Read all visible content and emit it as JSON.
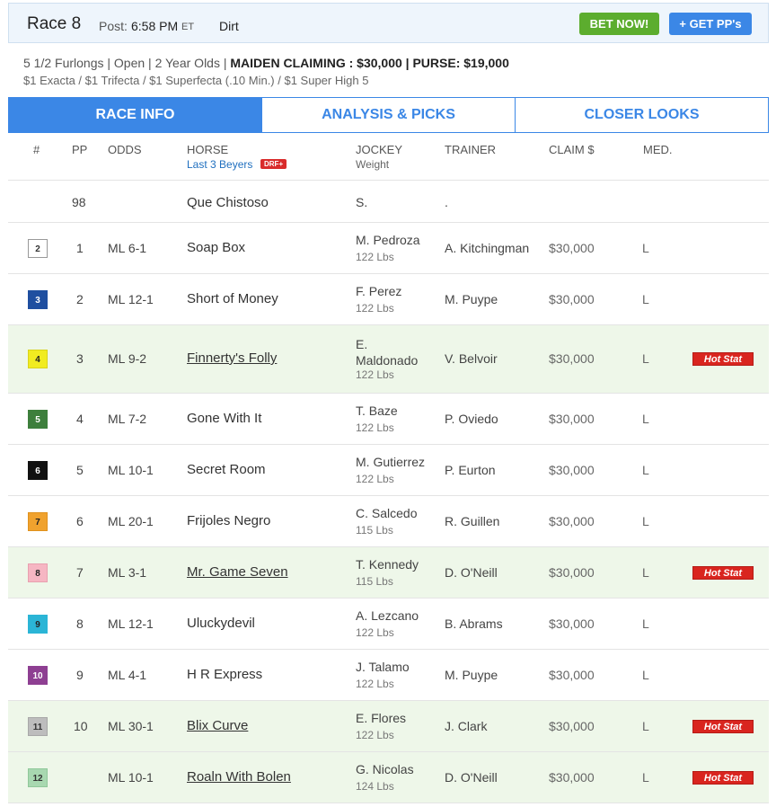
{
  "header": {
    "race": "Race 8",
    "post_label": "Post:",
    "post_time": "6:58 PM",
    "post_tz": "ET",
    "surface": "Dirt",
    "bet_button": "BET NOW!",
    "pp_button": "+ GET PP's"
  },
  "race_info": {
    "line1_prefix": "5 1/2 Furlongs | Open | 2 Year Olds | ",
    "line1_type": "MAIDEN CLAIMING : $30,000 | PURSE: $19,000",
    "line2": "$1 Exacta / $1 Trifecta / $1 Superfecta (.10 Min.) / $1 Super High 5"
  },
  "tabs": [
    {
      "label": "RACE INFO",
      "active": true
    },
    {
      "label": "ANALYSIS & PICKS",
      "active": false
    },
    {
      "label": "CLOSER LOOKS",
      "active": false
    }
  ],
  "columns": {
    "num": "#",
    "pp": "PP",
    "odds": "ODDS",
    "horse": "HORSE",
    "horse_sub": "Last 3 Beyers",
    "drf_badge": "DRF+",
    "jockey": "JOCKEY",
    "jockey_sub": "Weight",
    "trainer": "TRAINER",
    "claim": "CLAIM $",
    "med": "MED."
  },
  "hot_stat_label": "Hot Stat",
  "top_row": {
    "pp": "98",
    "horse": "Que Chistoso",
    "jockey": "S.",
    "trainer": "."
  },
  "entries": [
    {
      "num": "2",
      "pp": "1",
      "odds": "ML 6-1",
      "horse": "Soap Box",
      "jockey": "M. Pedroza",
      "weight": "122 Lbs",
      "trainer": "A. Kitchingman",
      "claim": "$30,000",
      "med": "L",
      "hot": false,
      "color": "#ffffff",
      "text_color": "#333333",
      "border": "#999999"
    },
    {
      "num": "3",
      "pp": "2",
      "odds": "ML 12-1",
      "horse": "Short of Money",
      "jockey": "F. Perez",
      "weight": "122 Lbs",
      "trainer": "M. Puype",
      "claim": "$30,000",
      "med": "L",
      "hot": false,
      "color": "#1f4fa0",
      "text_color": "#ffffff",
      "border": "#1f4fa0"
    },
    {
      "num": "4",
      "pp": "3",
      "odds": "ML 9-2",
      "horse": "Finnerty's Folly",
      "jockey": "E. Maldonado",
      "weight": "122 Lbs",
      "trainer": "V. Belvoir",
      "claim": "$30,000",
      "med": "L",
      "hot": true,
      "color": "#f1ec21",
      "text_color": "#222222",
      "border": "#d9d31a"
    },
    {
      "num": "5",
      "pp": "4",
      "odds": "ML 7-2",
      "horse": "Gone With It",
      "jockey": "T. Baze",
      "weight": "122 Lbs",
      "trainer": "P. Oviedo",
      "claim": "$30,000",
      "med": "L",
      "hot": false,
      "color": "#3d7f3c",
      "text_color": "#ffffff",
      "border": "#3d7f3c"
    },
    {
      "num": "6",
      "pp": "5",
      "odds": "ML 10-1",
      "horse": "Secret Room",
      "jockey": "M. Gutierrez",
      "weight": "122 Lbs",
      "trainer": "P. Eurton",
      "claim": "$30,000",
      "med": "L",
      "hot": false,
      "color": "#111111",
      "text_color": "#ffffff",
      "border": "#111111"
    },
    {
      "num": "7",
      "pp": "6",
      "odds": "ML 20-1",
      "horse": "Frijoles Negro",
      "jockey": "C. Salcedo",
      "weight": "115 Lbs",
      "trainer": "R. Guillen",
      "claim": "$30,000",
      "med": "L",
      "hot": false,
      "color": "#f0a22e",
      "text_color": "#222222",
      "border": "#e0921e"
    },
    {
      "num": "8",
      "pp": "7",
      "odds": "ML 3-1",
      "horse": "Mr. Game Seven",
      "jockey": "T. Kennedy",
      "weight": "115 Lbs",
      "trainer": "D. O'Neill",
      "claim": "$30,000",
      "med": "L",
      "hot": true,
      "color": "#f6b6c3",
      "text_color": "#222222",
      "border": "#e8a0b0"
    },
    {
      "num": "9",
      "pp": "8",
      "odds": "ML 12-1",
      "horse": "Uluckydevil",
      "jockey": "A. Lezcano",
      "weight": "122 Lbs",
      "trainer": "B. Abrams",
      "claim": "$30,000",
      "med": "L",
      "hot": false,
      "color": "#2bb5d6",
      "text_color": "#222222",
      "border": "#2bb5d6"
    },
    {
      "num": "10",
      "pp": "9",
      "odds": "ML 4-1",
      "horse": "H R Express",
      "jockey": "J. Talamo",
      "weight": "122 Lbs",
      "trainer": "M. Puype",
      "claim": "$30,000",
      "med": "L",
      "hot": false,
      "color": "#8e3f92",
      "text_color": "#ffffff",
      "border": "#8e3f92"
    },
    {
      "num": "11",
      "pp": "10",
      "odds": "ML 30-1",
      "horse": "Blix Curve",
      "jockey": "E. Flores",
      "weight": "122 Lbs",
      "trainer": "J. Clark",
      "claim": "$30,000",
      "med": "L",
      "hot": true,
      "color": "#bdbdbd",
      "text_color": "#333333",
      "border": "#a8a8a8"
    },
    {
      "num": "12",
      "pp": "",
      "odds": "ML 10-1",
      "horse": "Roaln With Bolen",
      "jockey": "G. Nicolas",
      "weight": "124 Lbs",
      "trainer": "D. O'Neill",
      "claim": "$30,000",
      "med": "L",
      "hot": true,
      "color": "#a8d8b0",
      "text_color": "#333333",
      "border": "#90c89a"
    }
  ]
}
